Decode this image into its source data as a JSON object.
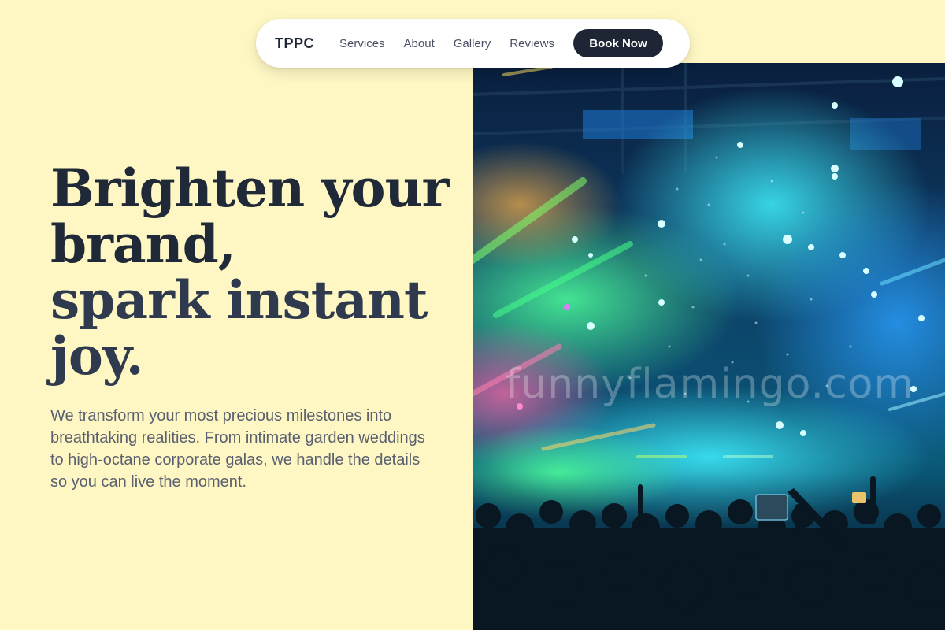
{
  "nav": {
    "brand": "TPPC",
    "links": [
      "Services",
      "About",
      "Gallery",
      "Reviews"
    ],
    "cta": "Book Now"
  },
  "hero": {
    "title_line1": "Brighten your brand,",
    "title_line2": "spark instant joy.",
    "description": "We transform your most precious milestones into breathtaking realities. From intimate garden weddings to high-octane corporate galas, we handle the details so you can live the moment."
  },
  "image": {
    "subject": "concert crowd with stage lights and confetti",
    "watermark": "funnyflamingo.com"
  },
  "colors": {
    "background": "#fef7c3",
    "primary_dark": "#1e2535",
    "text_muted": "#5a6070",
    "nav_bg": "#ffffff"
  }
}
